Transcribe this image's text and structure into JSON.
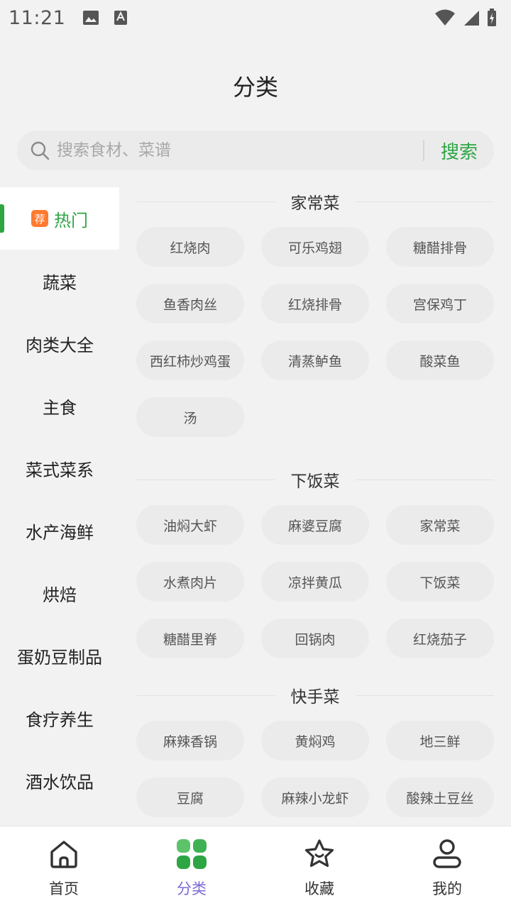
{
  "status_bar": {
    "time": "11:21"
  },
  "header": {
    "title": "分类"
  },
  "search": {
    "placeholder": "搜索食材、菜谱",
    "button_label": "搜索"
  },
  "sidebar": {
    "hot_badge": "荐",
    "items": [
      {
        "label": "热门"
      },
      {
        "label": "蔬菜"
      },
      {
        "label": "肉类大全"
      },
      {
        "label": "主食"
      },
      {
        "label": "菜式菜系"
      },
      {
        "label": "水产海鲜"
      },
      {
        "label": "烘焙"
      },
      {
        "label": "蛋奶豆制品"
      },
      {
        "label": "食疗养生"
      },
      {
        "label": "酒水饮品"
      }
    ]
  },
  "sections": [
    {
      "title": "家常菜",
      "tags": [
        "红烧肉",
        "可乐鸡翅",
        "糖醋排骨",
        "鱼香肉丝",
        "红烧排骨",
        "宫保鸡丁",
        "西红柿炒鸡蛋",
        "清蒸鲈鱼",
        "酸菜鱼",
        "汤"
      ]
    },
    {
      "title": "下饭菜",
      "tags": [
        "油焖大虾",
        "麻婆豆腐",
        "家常菜",
        "水煮肉片",
        "凉拌黄瓜",
        "下饭菜",
        "糖醋里脊",
        "回锅肉",
        "红烧茄子"
      ]
    },
    {
      "title": "快手菜",
      "tags": [
        "麻辣香锅",
        "黄焖鸡",
        "地三鲜",
        "豆腐",
        "麻辣小龙虾",
        "酸辣土豆丝"
      ]
    }
  ],
  "bottom_nav": [
    {
      "label": "首页",
      "icon": "home-icon"
    },
    {
      "label": "分类",
      "icon": "category-grid-icon"
    },
    {
      "label": "收藏",
      "icon": "star-icon"
    },
    {
      "label": "我的",
      "icon": "user-icon"
    }
  ],
  "colors": {
    "accent_green": "#2ea543",
    "nav_active_label": "#7b6cd6",
    "hot_badge": "#ff7a2f"
  }
}
